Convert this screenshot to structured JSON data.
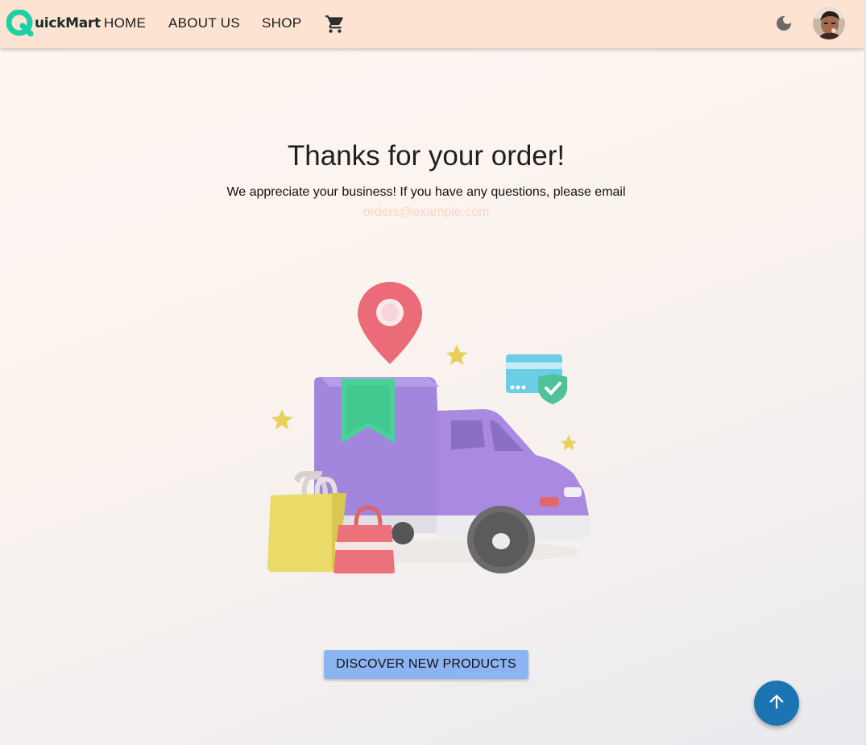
{
  "brand": {
    "name": "QuickMart",
    "logo_letter": "Q",
    "logo_rest": "uickMart",
    "color": "#1ccfa5"
  },
  "nav": {
    "links": [
      {
        "label": "HOME"
      },
      {
        "label": "ABOUT US"
      },
      {
        "label": "SHOP"
      }
    ],
    "cart_icon": "shopping-cart-icon",
    "theme_toggle_icon": "moon-icon",
    "avatar": "user-avatar"
  },
  "main": {
    "title": "Thanks for your order!",
    "message": "We appreciate your business! If you have any questions, please email",
    "email": "orders@example.com",
    "illustration": "delivery-truck-illustration",
    "cta_label": "DISCOVER NEW PRODUCTS"
  },
  "scroll_top": {
    "icon": "arrow-up-icon"
  },
  "colors": {
    "navbar_bg": "#fde4d2",
    "cta_bg": "#8cb4f2",
    "fab_bg": "#1b75b3",
    "email_text": "#f6d7c4"
  }
}
